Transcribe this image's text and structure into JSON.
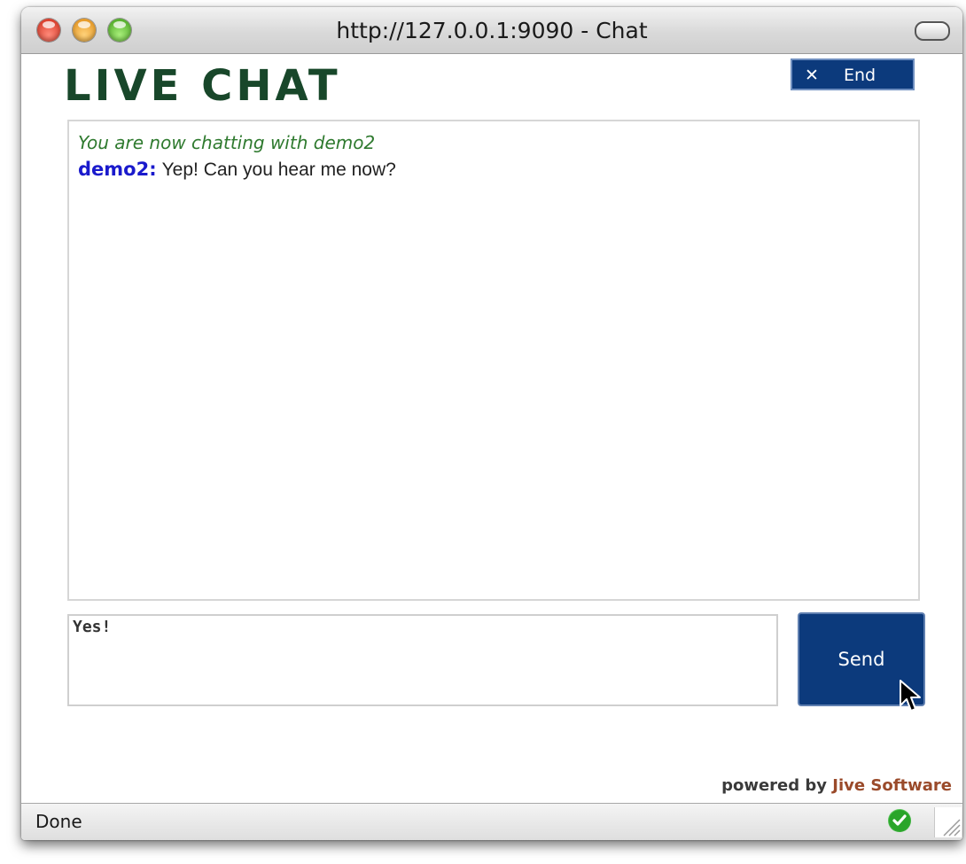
{
  "window": {
    "title": "http://127.0.0.1:9090 - Chat"
  },
  "header": {
    "logo_text": "LIVE CHAT",
    "end_button_icon": "close-icon",
    "end_button_label": "End"
  },
  "chat": {
    "system_message": "You are now chatting with demo2",
    "messages": [
      {
        "sender": "demo2:",
        "text": "Yep! Can you hear me now?"
      }
    ]
  },
  "composer": {
    "input_value": "Yes!",
    "send_label": "Send"
  },
  "footer": {
    "powered_prefix": "powered by",
    "powered_brand": "Jive Software"
  },
  "statusbar": {
    "status_text": "Done",
    "status_icon": "check-circle-icon"
  },
  "colors": {
    "logo": "#18472a",
    "button_bg": "#0c3a7c",
    "system_message": "#2f7a2f",
    "sender": "#1a1acc",
    "brand": "#9a4a2a"
  }
}
